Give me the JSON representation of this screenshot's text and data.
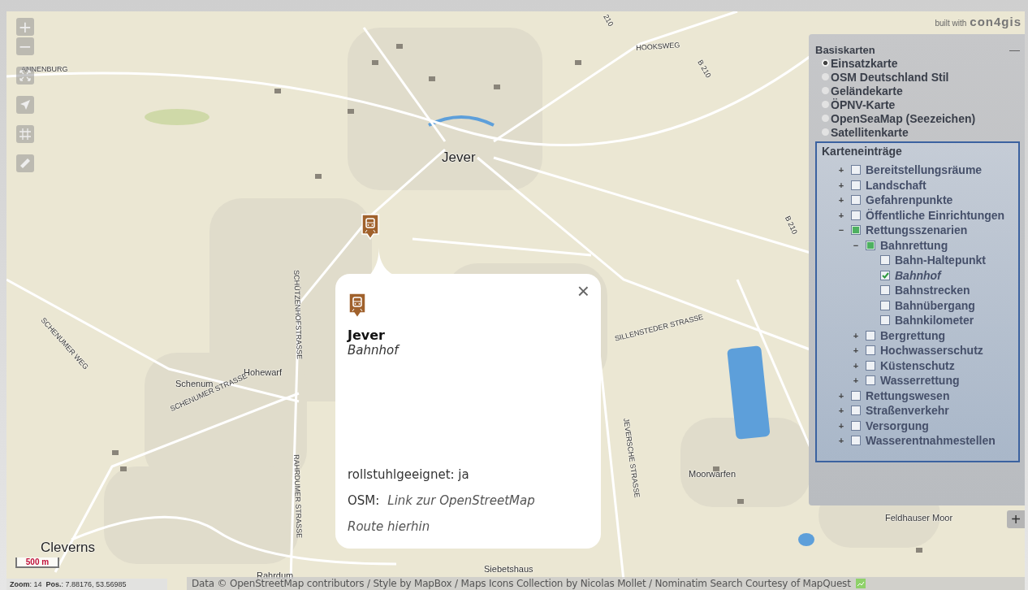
{
  "map_controls": {
    "zoom_in": "+",
    "zoom_out": "−"
  },
  "map_labels": [
    {
      "text": "ANNENBURG",
      "kind": "street"
    },
    {
      "text": "HOOKSWEG",
      "kind": "street"
    },
    {
      "text": "210",
      "kind": "street"
    },
    {
      "text": "B 210",
      "kind": "street"
    },
    {
      "text": "B 210",
      "kind": "street"
    },
    {
      "text": "Jever",
      "kind": "town"
    },
    {
      "text": "SCHENUMER WEG",
      "kind": "street"
    },
    {
      "text": "SCHÜTZENHOFSTRASSE",
      "kind": "street"
    },
    {
      "text": "SILLENSTEDER STRASSE",
      "kind": "street"
    },
    {
      "text": "Hohewarf",
      "kind": "place"
    },
    {
      "text": "Schenum",
      "kind": "place"
    },
    {
      "text": "SCHENUMER STRASSE",
      "kind": "street"
    },
    {
      "text": "RAHRDUMER STRASSE",
      "kind": "street"
    },
    {
      "text": "JEVERSCHE STRASSE",
      "kind": "street"
    },
    {
      "text": "Moorwarfen",
      "kind": "place"
    },
    {
      "text": "Feldhauser Moor",
      "kind": "place"
    },
    {
      "text": "Cleverns",
      "kind": "town"
    },
    {
      "text": "Rahrdum",
      "kind": "place"
    },
    {
      "text": "Siebetshaus",
      "kind": "place"
    }
  ],
  "branding": {
    "prefix": "built with",
    "logo": "con4gis"
  },
  "scale": "500 m",
  "popup": {
    "title": "Jever",
    "subtitle": "Bahnhof",
    "close": "×",
    "attribute": "rollstuhlgeeignet: ja",
    "osm_label": "OSM:",
    "osm_link": "Link zur OpenStreetMap",
    "route_link": "Route hierhin"
  },
  "panel": {
    "title": "Basiskarten",
    "collapse": "—",
    "basemaps": [
      {
        "label": "Einsatzkarte",
        "selected": true
      },
      {
        "label": "OSM Deutschland Stil",
        "selected": false
      },
      {
        "label": "Geländekarte",
        "selected": false
      },
      {
        "label": "ÖPNV-Karte",
        "selected": false
      },
      {
        "label": "OpenSeaMap (Seezeichen)",
        "selected": false
      },
      {
        "label": "Satellitenkarte",
        "selected": false
      }
    ],
    "layers_title": "Karteneinträge",
    "layers": [
      {
        "label": "Bereitstellungsräume",
        "kind": "group",
        "toggle": "+",
        "checked": false,
        "partial": false,
        "active": false
      },
      {
        "label": "Landschaft",
        "kind": "group",
        "toggle": "+",
        "checked": false,
        "partial": false,
        "active": false
      },
      {
        "label": "Gefahrenpunkte",
        "kind": "group",
        "toggle": "+",
        "checked": false,
        "partial": false,
        "active": false
      },
      {
        "label": "Öffentliche Einrichtungen",
        "kind": "group",
        "toggle": "+",
        "checked": false,
        "partial": false,
        "active": false
      },
      {
        "label": "Rettungsszenarien",
        "kind": "group",
        "toggle": "−",
        "checked": false,
        "partial": true,
        "active": false,
        "children": [
          {
            "label": "Bahnrettung",
            "kind": "group",
            "toggle": "−",
            "checked": false,
            "partial": true,
            "active": false,
            "children": [
              {
                "label": "Bahn-Haltepunkt",
                "kind": "leaf",
                "checked": false,
                "active": false
              },
              {
                "label": "Bahnhof",
                "kind": "leaf",
                "checked": true,
                "active": true
              },
              {
                "label": "Bahnstrecken",
                "kind": "leaf",
                "checked": false,
                "active": false
              },
              {
                "label": "Bahnübergang",
                "kind": "leaf",
                "checked": false,
                "active": false
              },
              {
                "label": "Bahnkilometer",
                "kind": "leaf",
                "checked": false,
                "active": false
              }
            ]
          },
          {
            "label": "Bergrettung",
            "kind": "group",
            "toggle": "+",
            "checked": false,
            "partial": false,
            "active": false
          },
          {
            "label": "Hochwasserschutz",
            "kind": "group",
            "toggle": "+",
            "checked": false,
            "partial": false,
            "active": false
          },
          {
            "label": "Küstenschutz",
            "kind": "group",
            "toggle": "+",
            "checked": false,
            "partial": false,
            "active": false
          },
          {
            "label": "Wasserrettung",
            "kind": "group",
            "toggle": "+",
            "checked": false,
            "partial": false,
            "active": false
          }
        ]
      },
      {
        "label": "Rettungswesen",
        "kind": "group",
        "toggle": "+",
        "checked": false,
        "partial": false,
        "active": false
      },
      {
        "label": "Straßenverkehr",
        "kind": "group",
        "toggle": "+",
        "checked": false,
        "partial": false,
        "active": false
      },
      {
        "label": "Versorgung",
        "kind": "group",
        "toggle": "+",
        "checked": false,
        "partial": false,
        "active": false
      },
      {
        "label": "Wasserentnahmestellen",
        "kind": "group",
        "toggle": "+",
        "checked": false,
        "partial": false,
        "active": false
      }
    ]
  },
  "side_expand": "+",
  "status": {
    "position": "**Zoom**: 14  **Pos.**: 7.88176, 53.56985",
    "attribution": "Data © OpenStreetMap contributors / Style by MapBox / Maps Icons Collection by Nicolas Mollet / Nominatim Search Courtesy of MapQuest"
  }
}
